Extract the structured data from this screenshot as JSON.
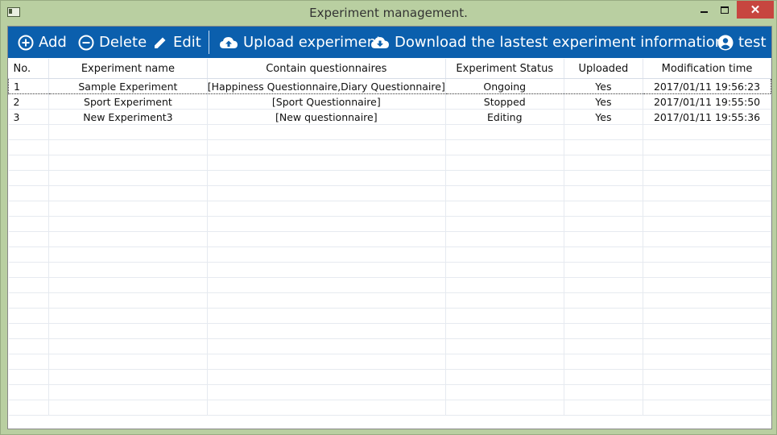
{
  "window": {
    "title": "Experiment management."
  },
  "toolbar": {
    "add_label": "Add",
    "delete_label": "Delete",
    "edit_label": "Edit",
    "upload_label": "Upload experiment",
    "download_label": "Download the lastest experiment information.",
    "user_label": "test"
  },
  "colors": {
    "toolbar_bg": "#0b5fad",
    "window_bg": "#b9cfa1",
    "close_bg": "#c7463f"
  },
  "table": {
    "columns": [
      "No.",
      "Experiment name",
      "Contain questionnaires",
      "Experiment Status",
      "Uploaded",
      "Modification time"
    ],
    "rows": [
      [
        "1",
        "Sample Experiment",
        "[Happiness Questionnaire,Diary Questionnaire]",
        "Ongoing",
        "Yes",
        "2017/01/11 19:56:23"
      ],
      [
        "2",
        "Sport Experiment",
        "[Sport Questionnaire]",
        "Stopped",
        "Yes",
        "2017/01/11 19:55:50"
      ],
      [
        "3",
        "New Experiment3",
        "[New questionnaire]",
        "Editing",
        "Yes",
        "2017/01/11 19:55:36"
      ]
    ],
    "selected_row": 0
  }
}
